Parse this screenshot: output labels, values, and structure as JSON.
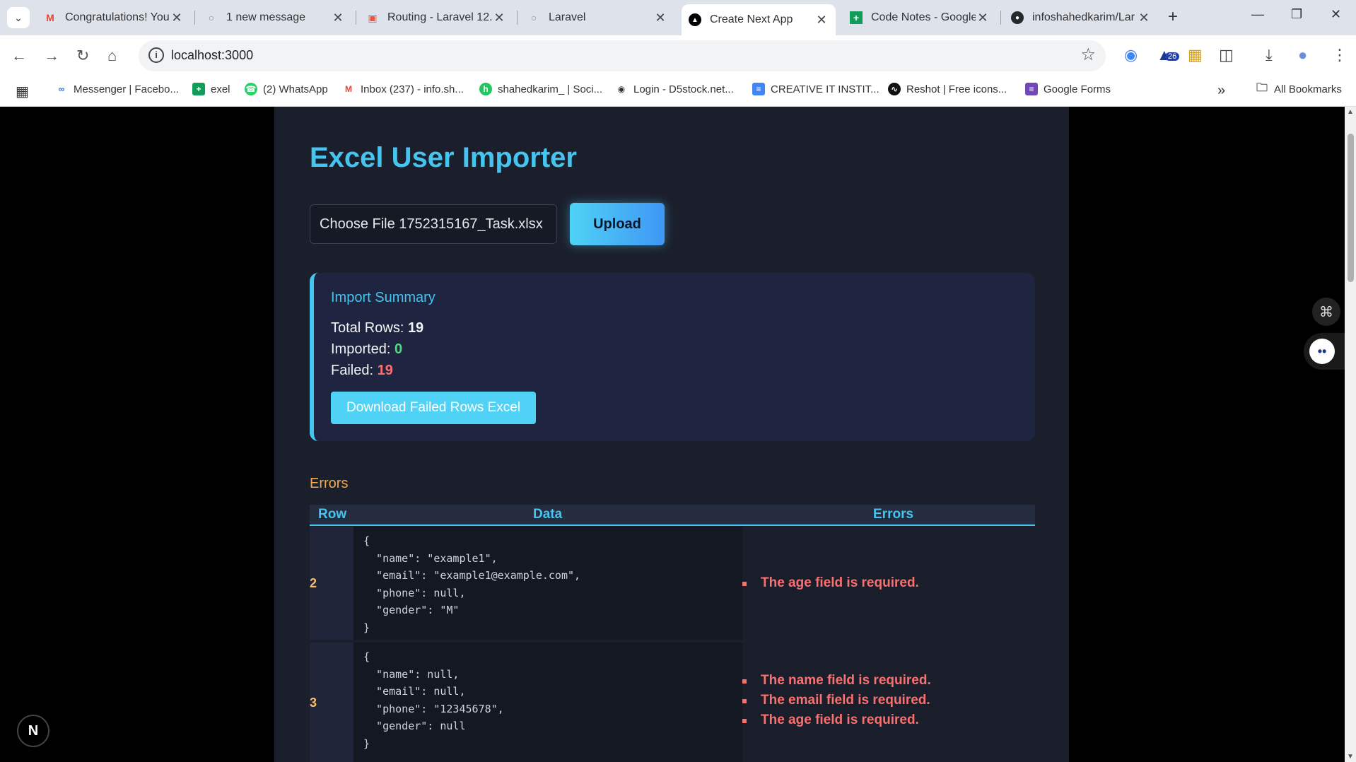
{
  "browser": {
    "tabs": [
      {
        "title": "Congratulations! You",
        "favicon": "gmail-icon"
      },
      {
        "title": "1 new message",
        "favicon": "globe-icon"
      },
      {
        "title": "Routing - Laravel 12.x",
        "favicon": "laravel-icon"
      },
      {
        "title": "Laravel",
        "favicon": "globe-icon"
      },
      {
        "title": "Create Next App",
        "favicon": "nextjs-icon",
        "active": true
      },
      {
        "title": "Code Notes - Google",
        "favicon": "sheets-icon"
      },
      {
        "title": "infoshahedkarim/Lar",
        "favicon": "github-icon"
      }
    ],
    "url": "localhost:3000",
    "extension_badge": "26",
    "bookmarks": [
      {
        "label": "Messenger | Facebo...",
        "icon": "meta-icon"
      },
      {
        "label": "exel",
        "icon": "sheets-icon"
      },
      {
        "label": "(2) WhatsApp",
        "icon": "whatsapp-icon"
      },
      {
        "label": "Inbox (237) - info.sh...",
        "icon": "gmail-icon"
      },
      {
        "label": "shahedkarim_ | Soci...",
        "icon": "social-icon"
      },
      {
        "label": "Login - D5stock.net...",
        "icon": "globe-icon"
      },
      {
        "label": "CREATIVE IT INSTIT...",
        "icon": "docs-icon"
      },
      {
        "label": "Reshot | Free icons...",
        "icon": "reshot-icon"
      },
      {
        "label": "Google Forms",
        "icon": "forms-icon"
      }
    ],
    "all_bookmarks": "All Bookmarks",
    "colors": {
      "chrome_bg": "#dee3eb",
      "accent": "#45c4f0"
    }
  },
  "page": {
    "title": "Excel User Importer",
    "file_input": "Choose File 1752315167_Task.xlsx",
    "upload_label": "Upload",
    "summary": {
      "heading": "Import Summary",
      "total_label": "Total Rows:",
      "total_value": "19",
      "imported_label": "Imported:",
      "imported_value": "0",
      "failed_label": "Failed:",
      "failed_value": "19",
      "download_label": "Download Failed Rows Excel"
    },
    "errors_heading": "Errors",
    "table": {
      "columns": [
        "Row",
        "Data",
        "Errors"
      ],
      "rows": [
        {
          "row": "2",
          "data": "{\n  \"name\": \"example1\",\n  \"email\": \"example1@example.com\",\n  \"phone\": null,\n  \"gender\": \"M\"\n}",
          "errors": [
            "The age field is required."
          ]
        },
        {
          "row": "3",
          "data": "{\n  \"name\": null,\n  \"email\": null,\n  \"phone\": \"12345678\",\n  \"gender\": null\n}",
          "errors": [
            "The name field is required.",
            "The email field is required.",
            "The age field is required."
          ]
        }
      ]
    },
    "next_badge": "N",
    "colors": {
      "success": "#4ade80",
      "danger": "#f87171",
      "warning": "#f0a94f"
    }
  }
}
